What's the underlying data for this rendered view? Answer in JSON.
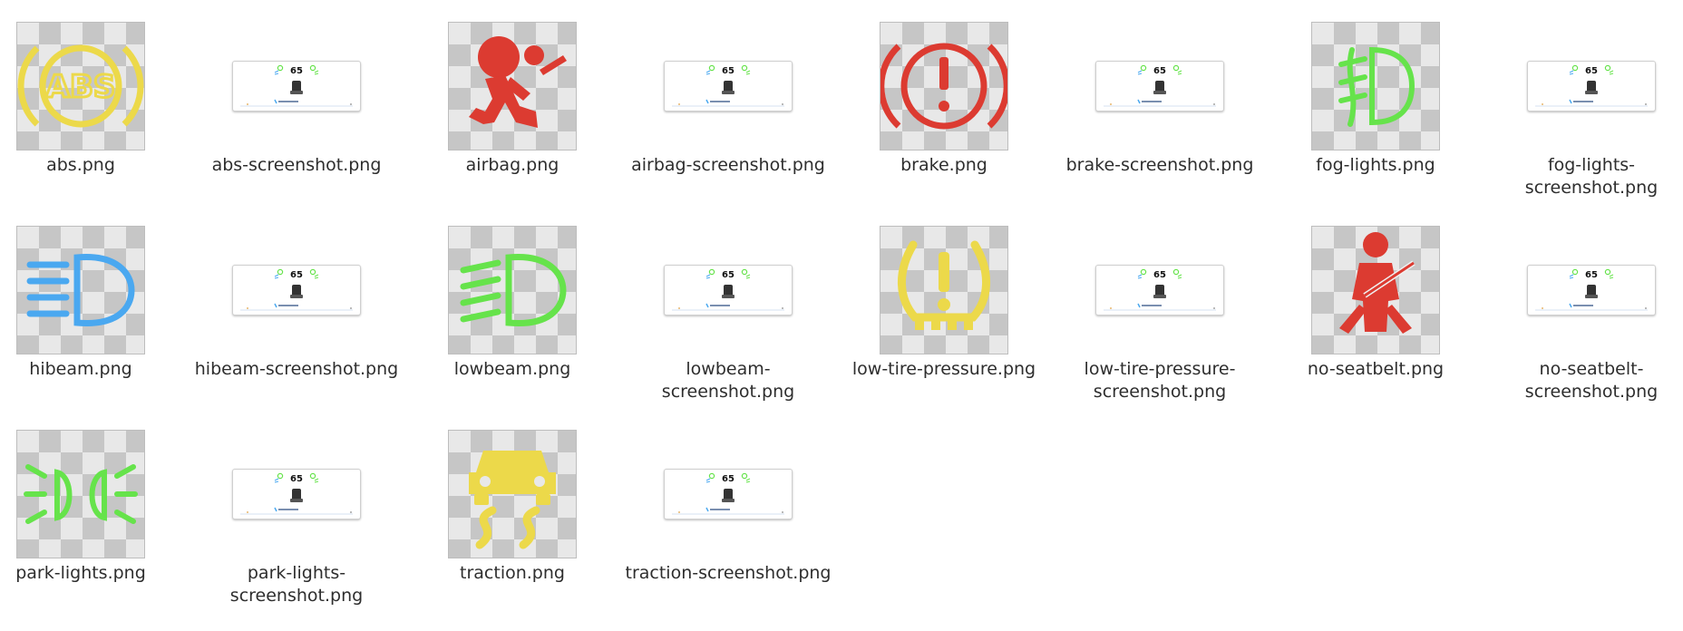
{
  "files": [
    {
      "name": "abs.png",
      "kind": "icon",
      "icon": "abs-warning-icon",
      "color": "#ecd94a"
    },
    {
      "name": "abs-screenshot.png",
      "kind": "screenshot",
      "icon": "screenshot-thumbnail",
      "speed": "65"
    },
    {
      "name": "airbag.png",
      "kind": "icon",
      "icon": "airbag-warning-icon",
      "color": "#dc3b31"
    },
    {
      "name": "airbag-screenshot.png",
      "kind": "screenshot",
      "icon": "screenshot-thumbnail",
      "speed": "65"
    },
    {
      "name": "brake.png",
      "kind": "icon",
      "icon": "brake-warning-icon",
      "color": "#dc3b31"
    },
    {
      "name": "brake-screenshot.png",
      "kind": "screenshot",
      "icon": "screenshot-thumbnail",
      "speed": "65"
    },
    {
      "name": "fog-lights.png",
      "kind": "icon",
      "icon": "fog-lights-icon",
      "color": "#66e34b"
    },
    {
      "name": "fog-lights-screenshot.png",
      "kind": "screenshot",
      "icon": "screenshot-thumbnail",
      "speed": "65"
    },
    {
      "name": "hibeam.png",
      "kind": "icon",
      "icon": "high-beam-icon",
      "color": "#4aa8f0"
    },
    {
      "name": "hibeam-screenshot.png",
      "kind": "screenshot",
      "icon": "screenshot-thumbnail",
      "speed": "65"
    },
    {
      "name": "lowbeam.png",
      "kind": "icon",
      "icon": "low-beam-icon",
      "color": "#66e34b"
    },
    {
      "name": "lowbeam-screenshot.png",
      "kind": "screenshot",
      "icon": "screenshot-thumbnail",
      "speed": "65"
    },
    {
      "name": "low-tire-pressure.png",
      "kind": "icon",
      "icon": "tire-pressure-icon",
      "color": "#ecd94a"
    },
    {
      "name": "low-tire-pressure-screenshot.png",
      "kind": "screenshot",
      "icon": "screenshot-thumbnail",
      "speed": "65"
    },
    {
      "name": "no-seatbelt.png",
      "kind": "icon",
      "icon": "seatbelt-warning-icon",
      "color": "#dc3b31"
    },
    {
      "name": "no-seatbelt-screenshot.png",
      "kind": "screenshot",
      "icon": "screenshot-thumbnail",
      "speed": "65"
    },
    {
      "name": "park-lights.png",
      "kind": "icon",
      "icon": "park-lights-icon",
      "color": "#66e34b"
    },
    {
      "name": "park-lights-screenshot.png",
      "kind": "screenshot",
      "icon": "screenshot-thumbnail",
      "speed": "65"
    },
    {
      "name": "traction.png",
      "kind": "icon",
      "icon": "traction-control-icon",
      "color": "#ecd94a"
    },
    {
      "name": "traction-screenshot.png",
      "kind": "screenshot",
      "icon": "screenshot-thumbnail",
      "speed": "65"
    }
  ]
}
